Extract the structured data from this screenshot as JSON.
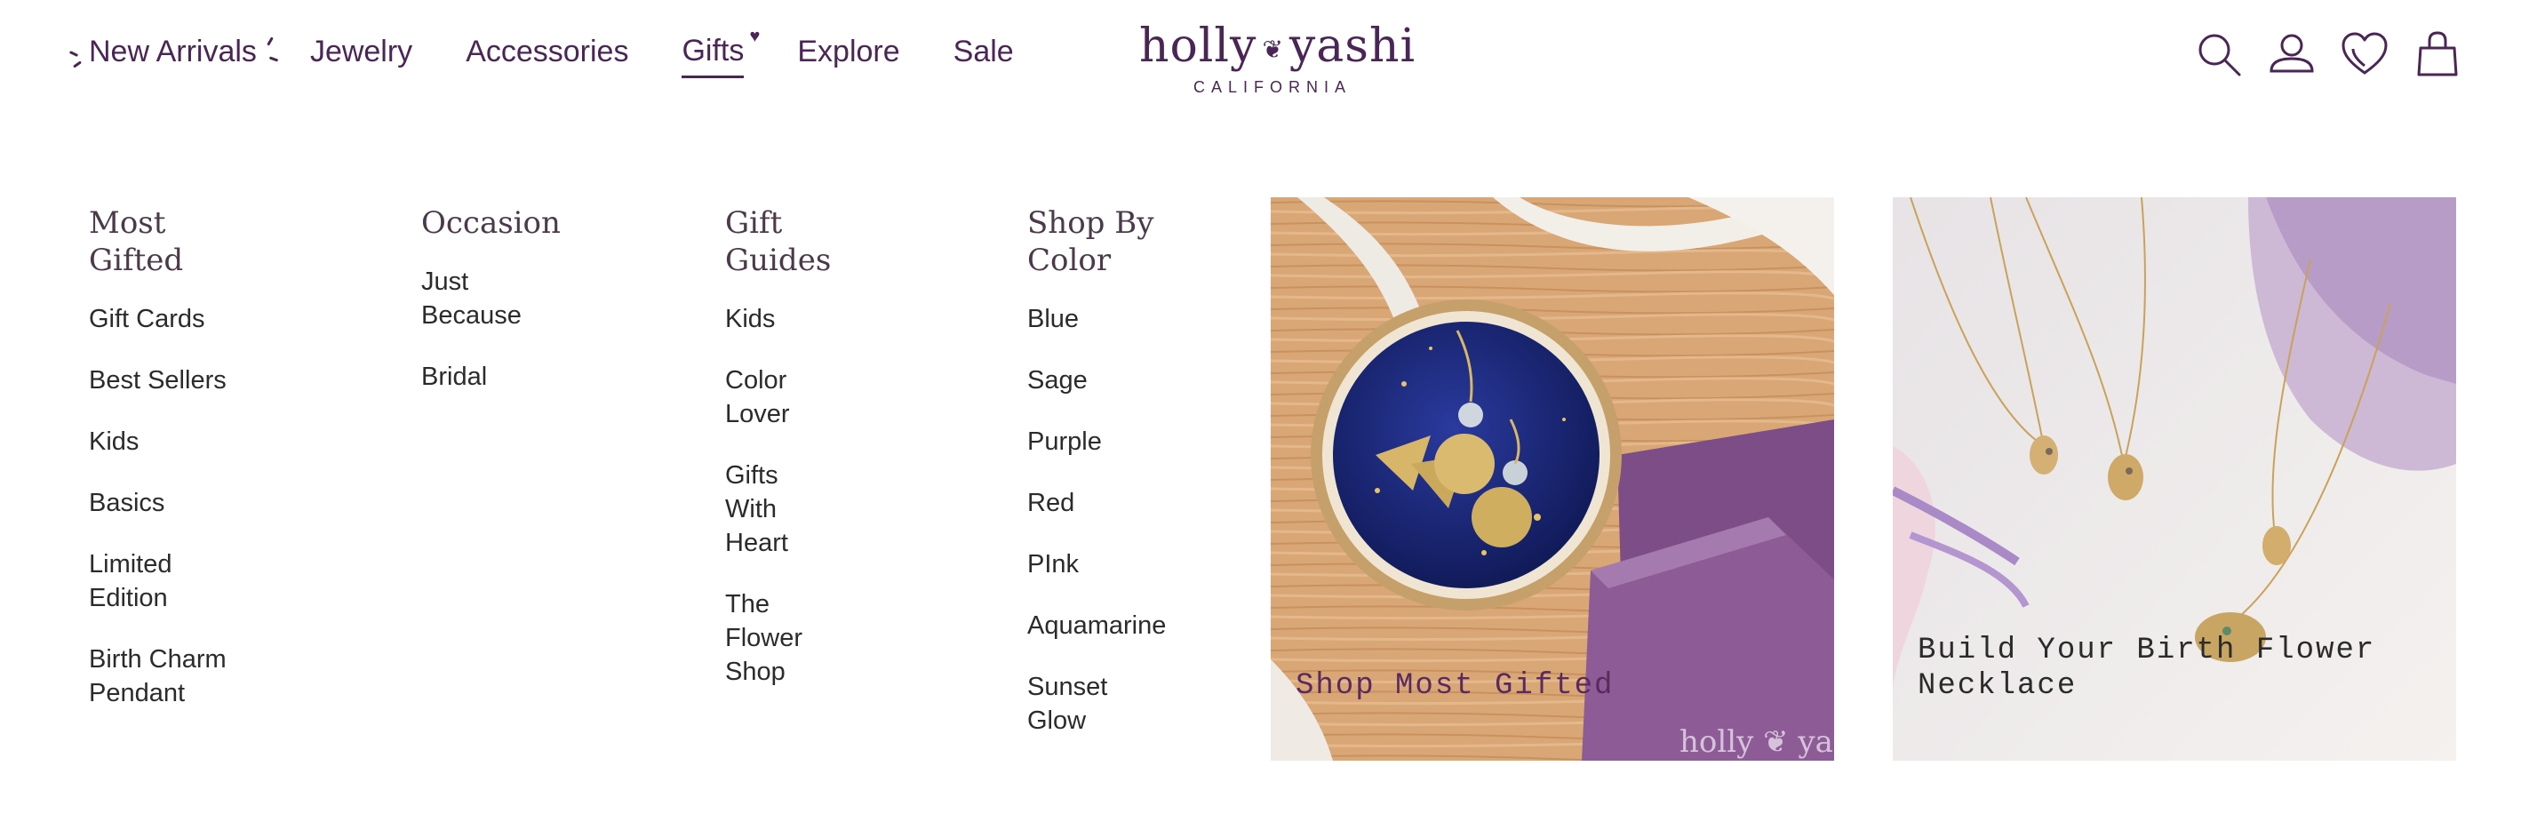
{
  "header": {
    "nav": [
      {
        "label": "New Arrivals"
      },
      {
        "label": "Jewelry"
      },
      {
        "label": "Accessories"
      },
      {
        "label": "Gifts"
      },
      {
        "label": "Explore"
      },
      {
        "label": "Sale"
      }
    ],
    "active_nav": "Gifts",
    "logo": {
      "text_left": "holly",
      "text_right": "yashi",
      "subtitle": "CALIFORNIA"
    },
    "icons": [
      "search-icon",
      "account-icon",
      "wishlist-heart-icon",
      "cart-bag-icon"
    ]
  },
  "menu": {
    "columns": [
      {
        "heading": "Most Gifted",
        "links": [
          "Gift Cards",
          "Best Sellers",
          "Kids",
          "Basics",
          "Limited Edition",
          "Birth Charm Pendant"
        ]
      },
      {
        "heading": "Occasion",
        "links": [
          "Just Because",
          "Bridal"
        ]
      },
      {
        "heading": "Gift Guides",
        "links": [
          "Kids",
          "Color Lover",
          "Gifts With Heart",
          "The Flower Shop"
        ]
      },
      {
        "heading": "Shop By Color",
        "links": [
          "Blue",
          "Sage",
          "Purple",
          "Red",
          "PInk",
          "Aquamarine",
          "Sunset Glow"
        ]
      }
    ],
    "promos": [
      {
        "label": "Shop Most Gifted",
        "watermark": "holly yashi"
      },
      {
        "label": "Build Your Birth Flower Necklace"
      }
    ]
  },
  "colors": {
    "brand": "#4a2556",
    "text": "#2b2b2b",
    "heading": "#4a3a4a"
  }
}
